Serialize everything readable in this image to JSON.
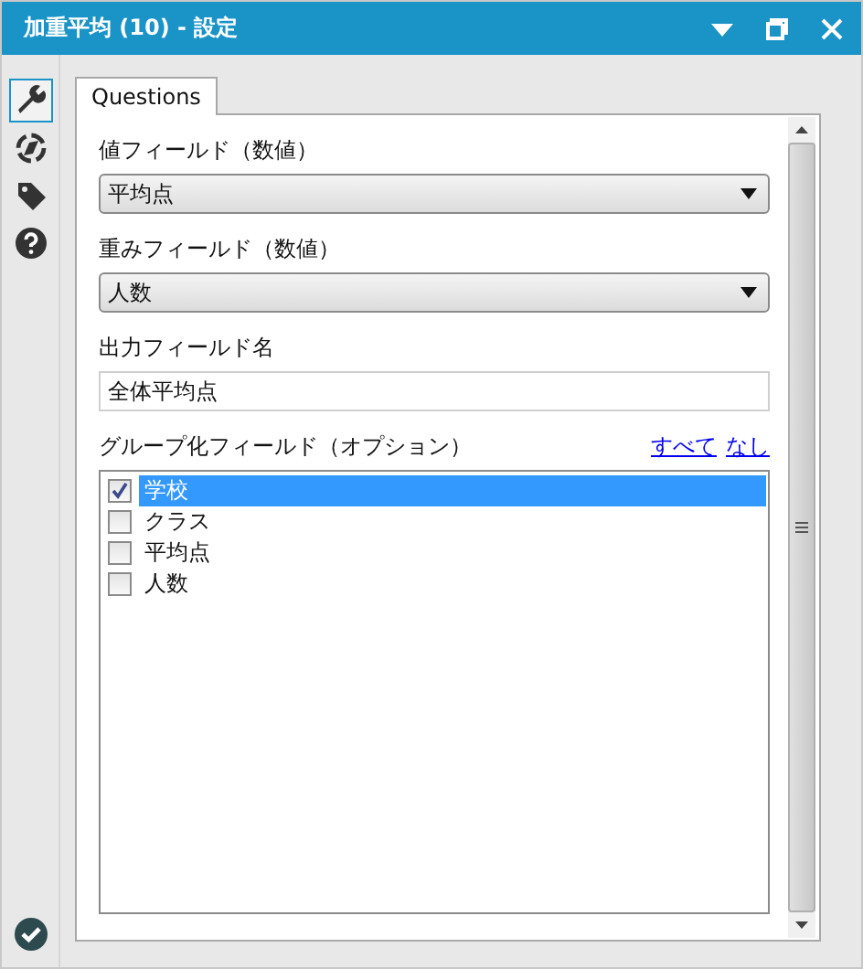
{
  "window": {
    "title": "加重平均 (10) - 設定"
  },
  "sidebar": {
    "items": [
      {
        "kind": "wrench",
        "selected": true
      },
      {
        "kind": "compass",
        "selected": false
      },
      {
        "kind": "tag",
        "selected": false
      },
      {
        "kind": "help",
        "selected": false
      }
    ],
    "footer": {
      "kind": "check"
    }
  },
  "tabs": [
    {
      "label": "Questions",
      "selected": true
    }
  ],
  "form": {
    "fields": [
      {
        "kind": "dropdown",
        "label": "値フィールド（数値）",
        "value": "平均点"
      },
      {
        "kind": "dropdown",
        "label": "重みフィールド（数値）",
        "value": "人数"
      },
      {
        "kind": "text",
        "label": "出力フィールド名",
        "value": "全体平均点"
      }
    ],
    "group": {
      "label": "グループ化フィールド（オプション）",
      "links": [
        "すべて",
        "なし"
      ],
      "items": [
        {
          "label": "学校",
          "checked": true,
          "selected": true
        },
        {
          "label": "クラス",
          "checked": false,
          "selected": false
        },
        {
          "label": "平均点",
          "checked": false,
          "selected": false
        },
        {
          "label": "人数",
          "checked": false,
          "selected": false
        }
      ]
    }
  }
}
